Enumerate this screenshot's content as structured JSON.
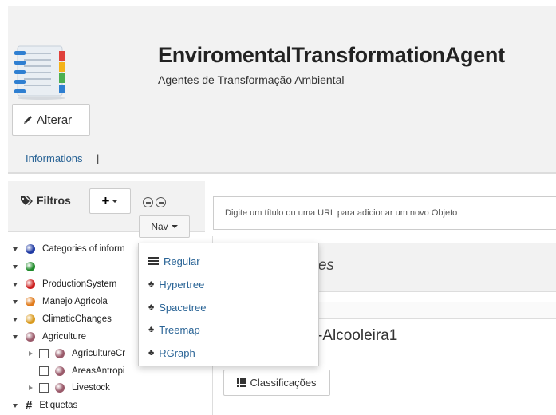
{
  "header": {
    "title": "EnviromentalTransformationAgent",
    "subtitle": "Agentes de Transformação Ambiental",
    "edit_button_label": "Alterar",
    "info_link": "Informations",
    "info_separator": "|"
  },
  "sidebar": {
    "filters_label": "Filtros",
    "add_button_label": "+",
    "nav_button_label": "Nav",
    "tree": [
      {
        "label": "Categories of inform",
        "color": "#1f3aa3",
        "marker": "dot",
        "expander": "down",
        "level": 0
      },
      {
        "label": "",
        "color": "#1f8a2a",
        "marker": "dot",
        "expander": "down",
        "level": 0
      },
      {
        "label": "ProductionSystem",
        "color": "#cc1f1f",
        "marker": "dot",
        "expander": "down",
        "level": 0
      },
      {
        "label": "Manejo Agricola",
        "color": "#e07a1a",
        "marker": "dot",
        "expander": "down",
        "level": 0
      },
      {
        "label": "ClimaticChanges",
        "color": "#d99a1e",
        "marker": "dot",
        "expander": "down",
        "level": 0
      },
      {
        "label": "Agriculture",
        "color": "#9a5a6a",
        "marker": "dot",
        "expander": "down",
        "level": 0
      },
      {
        "label": "AgricultureCr",
        "color": "#9a5a6a",
        "marker": "dot",
        "expander": "right",
        "level": 1
      },
      {
        "label": "AreasAntropi",
        "color": "#9a5a6a",
        "marker": "dot",
        "expander": "none",
        "level": 1
      },
      {
        "label": "Livestock",
        "color": "#9a5a6a",
        "marker": "dot",
        "expander": "right",
        "level": 1
      },
      {
        "label": "Etiquetas",
        "color": "#222222",
        "marker": "hash",
        "expander": "down",
        "level": 0
      }
    ]
  },
  "nav_menu": {
    "items": [
      {
        "label": "Regular",
        "icon": "list-icon"
      },
      {
        "label": "Hypertree",
        "icon": "tree-icon"
      },
      {
        "label": "Spacetree",
        "icon": "tree-icon"
      },
      {
        "label": "Treemap",
        "icon": "tree-icon"
      },
      {
        "label": "RGraph",
        "icon": "tree-icon"
      }
    ]
  },
  "main": {
    "url_placeholder": "Digite um título ou uma URL para adicionar um novo Objeto",
    "heading_fragment": "ntes",
    "object_title_fragment": "-Alcooleira1",
    "classify_button_label": "Classificações"
  }
}
